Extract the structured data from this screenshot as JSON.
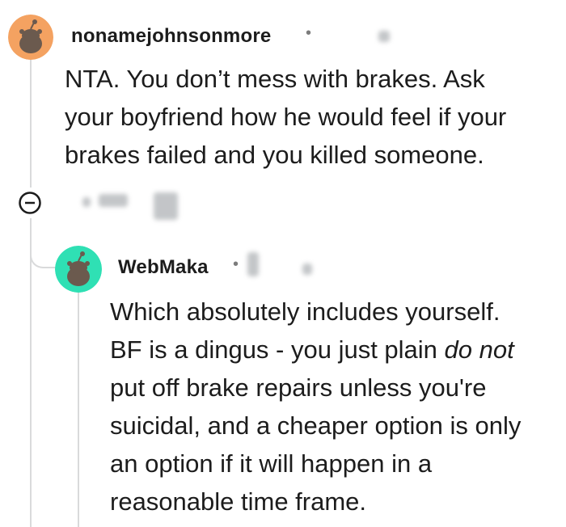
{
  "comments": [
    {
      "username": "nonamejohnsonmore",
      "separator": "•",
      "body_lines": [
        "NTA. You don’t mess with brakes. Ask",
        "your boyfriend how he would feel if your",
        "brakes failed and you killed someone."
      ],
      "avatar_color": "#f4a261"
    },
    {
      "username": "WebMaka",
      "separator": "•",
      "body_lines": [
        "Which absolutely includes yourself.",
        "BF is a dingus - you just plain ",
        "put off brake repairs unless you're",
        "suicidal, and a cheaper option is only",
        "an option if it will happen in a",
        "reasonable time frame."
      ],
      "body_emphasis": "do not",
      "avatar_color": "#2fe0b4"
    }
  ],
  "icons": {
    "collapse": "minus-circle-icon",
    "avatar": "snoo-avatar-icon"
  }
}
